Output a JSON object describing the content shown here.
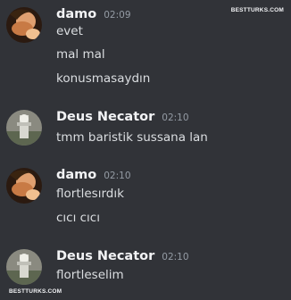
{
  "watermark": {
    "top": "BESTTURKS.COM",
    "bottom": "BESTTURKS.COM"
  },
  "colors": {
    "background": "#313338",
    "username": "#f2f3f5",
    "message": "#dbdee1",
    "timestamp": "#949ba4"
  },
  "groups": [
    {
      "username": "damo",
      "timestamp": "02:09",
      "avatar": "damo-avatar",
      "messages": [
        "evet",
        "mal mal",
        "konusmasaydın"
      ]
    },
    {
      "username": "Deus Necator",
      "timestamp": "02:10",
      "avatar": "deus-necator-avatar",
      "messages": [
        "tmm baristik sussana lan"
      ]
    },
    {
      "username": "damo",
      "timestamp": "02:10",
      "avatar": "damo-avatar",
      "messages": [
        "flortlesırdık",
        "cıcı cıcı"
      ]
    },
    {
      "username": "Deus Necator",
      "timestamp": "02:10",
      "avatar": "deus-necator-avatar",
      "messages": [
        "flortleselim"
      ]
    }
  ]
}
